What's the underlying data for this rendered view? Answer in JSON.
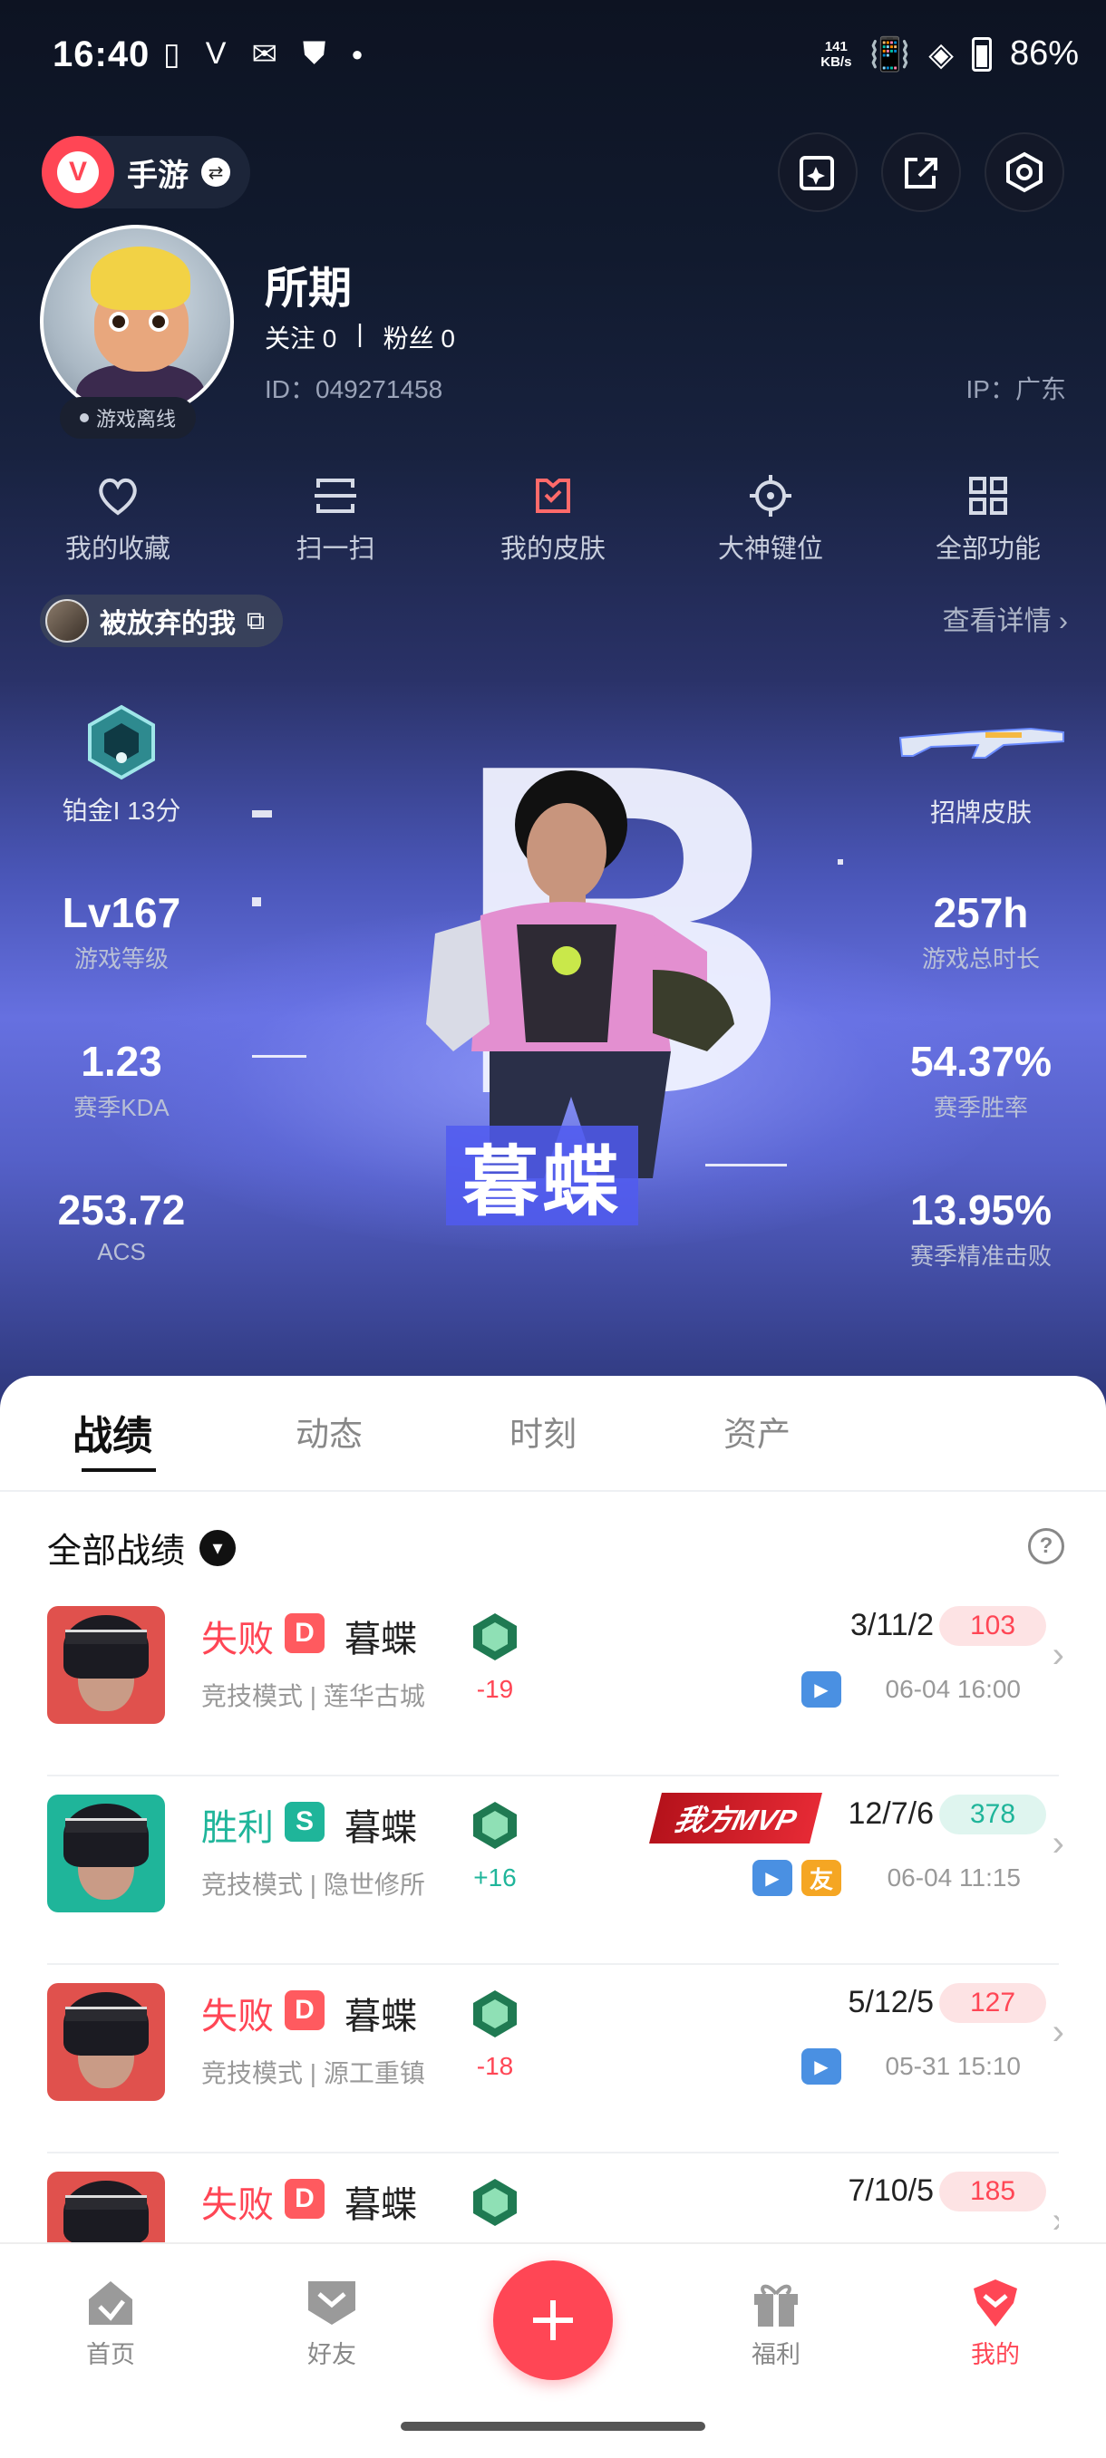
{
  "status_bar": {
    "time": "16:40",
    "speed_top": "141",
    "speed_bottom": "KB/s",
    "battery": "86%"
  },
  "top": {
    "app_label": "手游",
    "logo": "valorant-logo"
  },
  "profile": {
    "name": "所期",
    "follow_label": "关注 0",
    "sep": "|",
    "fans_label": "粉丝 0",
    "id": "ID：049271458",
    "ip": "IP：广东",
    "status": "游戏离线"
  },
  "functions": [
    {
      "label": "我的收藏",
      "icon": "heart-icon"
    },
    {
      "label": "扫一扫",
      "icon": "scan-icon"
    },
    {
      "label": "我的皮肤",
      "icon": "skin-icon"
    },
    {
      "label": "大神键位",
      "icon": "crosshair-icon"
    },
    {
      "label": "全部功能",
      "icon": "grid-icon"
    }
  ],
  "title_tag": "被放弃的我",
  "detail_link": "查看详情",
  "rank_label": "铂金I 13分",
  "skin_label": "招牌皮肤",
  "featured_agent": "暮蝶",
  "stats": {
    "level": {
      "value": "Lv167",
      "label": "游戏等级"
    },
    "hours": {
      "value": "257h",
      "label": "游戏总时长"
    },
    "kda": {
      "value": "1.23",
      "label": "赛季KDA"
    },
    "winrate": {
      "value": "54.37%",
      "label": "赛季胜率"
    },
    "acs": {
      "value": "253.72",
      "label": "ACS"
    },
    "hs": {
      "value": "13.95%",
      "label": "赛季精准击败"
    }
  },
  "tabs": [
    "战绩",
    "动态",
    "时刻",
    "资产"
  ],
  "filter_label": "全部战绩",
  "matches": [
    {
      "result": "失败",
      "badge": "D",
      "agent": "暮蝶",
      "mode": "竞技模式 | 莲华古城",
      "delta": "-19",
      "kda": "3/11/2",
      "acs": "103",
      "time": "06-04 16:00",
      "mvp": "",
      "friend": ""
    },
    {
      "result": "胜利",
      "badge": "S",
      "agent": "暮蝶",
      "mode": "竞技模式 | 隐世修所",
      "delta": "+16",
      "kda": "12/7/6",
      "acs": "378",
      "time": "06-04 11:15",
      "mvp": "我方MVP",
      "friend": "友"
    },
    {
      "result": "失败",
      "badge": "D",
      "agent": "暮蝶",
      "mode": "竞技模式 | 源工重镇",
      "delta": "-18",
      "kda": "5/12/5",
      "acs": "127",
      "time": "05-31 15:10",
      "mvp": "",
      "friend": ""
    },
    {
      "result": "失败",
      "badge": "D",
      "agent": "暮蝶",
      "mode": "",
      "delta": "",
      "kda": "7/10/5",
      "acs": "185",
      "time": "",
      "mvp": "",
      "friend": ""
    }
  ],
  "bottom_nav": [
    "首页",
    "好友",
    "福利",
    "我的"
  ],
  "colors": {
    "accent": "#ff4655",
    "win": "#1fb59a",
    "lose": "#ff4655"
  }
}
